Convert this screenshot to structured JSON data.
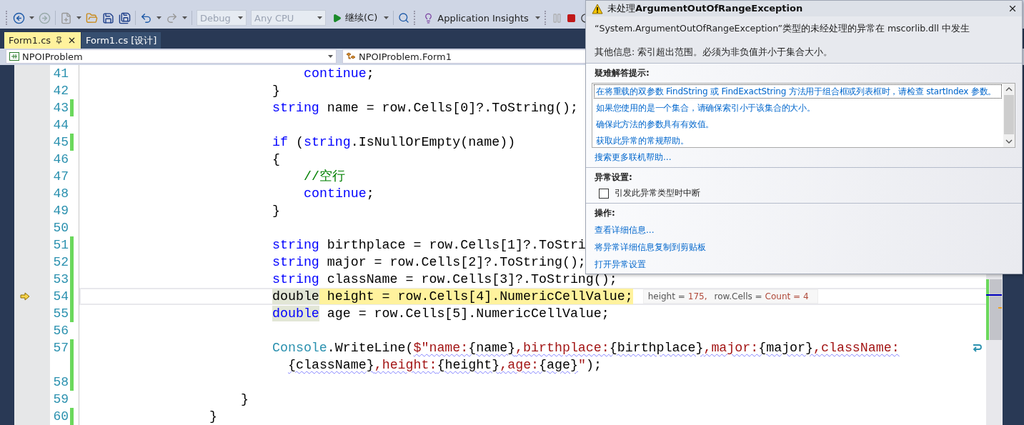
{
  "toolbar": {
    "configuration": "Debug",
    "platform": "Any CPU",
    "continue": "继续(C)",
    "insights": "Application Insights"
  },
  "tabs": [
    {
      "label": "Form1.cs",
      "selected": true
    },
    {
      "label": "Form1.cs [设计]",
      "selected": false
    }
  ],
  "nav": {
    "project": "NPOIProblem",
    "type": "NPOIProblem.Form1"
  },
  "editor": {
    "lines": [
      {
        "number": "41",
        "changed": false,
        "current": false,
        "segments": [
          {
            "kind": "keyword",
            "text": "continue"
          },
          {
            "kind": "plain",
            "text": ";"
          }
        ]
      },
      {
        "number": "42",
        "changed": false,
        "current": false,
        "segments": [
          {
            "kind": "plain",
            "text": "}"
          }
        ]
      },
      {
        "number": "43",
        "changed": true,
        "current": false,
        "segments": [
          {
            "kind": "keyword",
            "text": "string"
          },
          {
            "kind": "plain",
            "text": " name = row.Cells[0]?.ToString();"
          }
        ]
      },
      {
        "number": "44",
        "changed": false,
        "current": false
      },
      {
        "number": "45",
        "changed": true,
        "current": false,
        "segments": [
          {
            "kind": "keyword",
            "text": "if"
          },
          {
            "kind": "plain",
            "text": " ("
          },
          {
            "kind": "keyword",
            "text": "string"
          },
          {
            "kind": "plain",
            "text": ".IsNullOrEmpty(name))"
          }
        ]
      },
      {
        "number": "46",
        "changed": false,
        "current": false,
        "segments": [
          {
            "kind": "plain",
            "text": "{"
          }
        ]
      },
      {
        "number": "47",
        "changed": false,
        "current": false,
        "segments": [
          {
            "kind": "comment",
            "text": "//空行"
          }
        ]
      },
      {
        "number": "48",
        "changed": false,
        "current": false,
        "segments": [
          {
            "kind": "keyword",
            "text": "continue"
          },
          {
            "kind": "plain",
            "text": ";"
          }
        ]
      },
      {
        "number": "49",
        "changed": false,
        "current": false,
        "segments": [
          {
            "kind": "plain",
            "text": "}"
          }
        ]
      },
      {
        "number": "50",
        "changed": false,
        "current": false
      },
      {
        "number": "51",
        "changed": true,
        "current": false,
        "segments": [
          {
            "kind": "keyword",
            "text": "string"
          },
          {
            "kind": "plain",
            "text": " birthplace = row.Cells[1]?.ToStri"
          }
        ]
      },
      {
        "number": "52",
        "changed": true,
        "current": false,
        "segments": [
          {
            "kind": "keyword",
            "text": "string"
          },
          {
            "kind": "plain",
            "text": " major = row.Cells[2]?.ToString();"
          }
        ]
      },
      {
        "number": "53",
        "changed": true,
        "current": false,
        "segments": [
          {
            "kind": "keyword",
            "text": "string"
          },
          {
            "kind": "plain",
            "text": " className = row.Cells[3]?.ToString();"
          }
        ]
      },
      {
        "number": "54",
        "changed": true,
        "current": true,
        "segments": [
          {
            "kind": "plain",
            "text": "double",
            "reference_highlight": true
          },
          {
            "kind": "plain",
            "text": " height = row.Cells[4].NumericCellValue;",
            "statement_highlight": true
          }
        ]
      },
      {
        "number": "55",
        "changed": true,
        "current": false,
        "segments": [
          {
            "kind": "keyword",
            "text": "double",
            "reference_highlight": true
          },
          {
            "kind": "plain",
            "text": " age = row.Cells[5].NumericCellValue;"
          }
        ]
      },
      {
        "number": "56",
        "changed": false,
        "current": false
      },
      {
        "number": "57",
        "changed": true,
        "current": false,
        "segments": [
          {
            "kind": "type",
            "text": "Console"
          },
          {
            "kind": "plain",
            "text": ".WriteLine("
          },
          {
            "kind": "string",
            "text": "$\"name:",
            "squiggle": true
          },
          {
            "kind": "plain",
            "text": "{name}",
            "squiggle": true
          },
          {
            "kind": "string",
            "text": ",birthplace:",
            "squiggle": true
          },
          {
            "kind": "plain",
            "text": "{birthplace}",
            "squiggle": true
          },
          {
            "kind": "string",
            "text": ",major:",
            "squiggle": true
          },
          {
            "kind": "plain",
            "text": "{major}",
            "squiggle": true
          },
          {
            "kind": "string",
            "text": ",className:",
            "squiggle": true
          }
        ],
        "continuation": [
          {
            "kind": "plain",
            "text": "{className}",
            "squiggle": true
          },
          {
            "kind": "string",
            "text": ",height:",
            "squiggle": true
          },
          {
            "kind": "plain",
            "text": "{height}",
            "squiggle": true
          },
          {
            "kind": "string",
            "text": ",age:",
            "squiggle": true
          },
          {
            "kind": "plain",
            "text": "{age}",
            "squiggle": true
          },
          {
            "kind": "string",
            "text": "\""
          },
          {
            "kind": "plain",
            "text": ");"
          }
        ]
      },
      {
        "number": "58",
        "changed": true,
        "current": false
      },
      {
        "number": "59",
        "changed": false,
        "current": false,
        "segments": [
          {
            "kind": "plain",
            "text": "}"
          }
        ]
      },
      {
        "number": "60",
        "changed": true,
        "current": false,
        "segments": [
          {
            "kind": "plain",
            "text": "}"
          }
        ]
      }
    ]
  },
  "datatip": [
    {
      "name": "height =",
      "value": "175,"
    },
    {
      "name": "row.Cells =",
      "value": "Count = 4"
    }
  ],
  "exception": {
    "title": "未处理**ArgumentOutOfRangeException**",
    "message": "“System.ArgumentOutOfRangeException”类型的未经处理的异常在 mscorlib.dll 中发生",
    "details": "其他信息: 索引超出范围。必须为非负值并小于集合大小。",
    "tips_heading": "疑难解答提示:",
    "tips": [
      {
        "text": "在将重载的双参数 FindString 或 FindExactString 方法用于组合框或列表框时，请检查 startIndex 参数。",
        "selected": true
      },
      {
        "text": "如果您使用的是一个集合，请确保索引小于该集合的大小。",
        "selected": false
      },
      {
        "text": "确保此方法的参数具有有效值。",
        "selected": false
      },
      {
        "text": "获取此异常的常规帮助。",
        "selected": false
      }
    ],
    "search_link": "搜索更多联机帮助...",
    "settings_heading": "异常设置:",
    "break_option": {
      "label": "引发此异常类型时中断",
      "checked": false
    },
    "actions_heading": "操作:",
    "actions": [
      "查看详细信息...",
      "将异常详细信息复制到剪贴板",
      "打开异常设置"
    ]
  }
}
